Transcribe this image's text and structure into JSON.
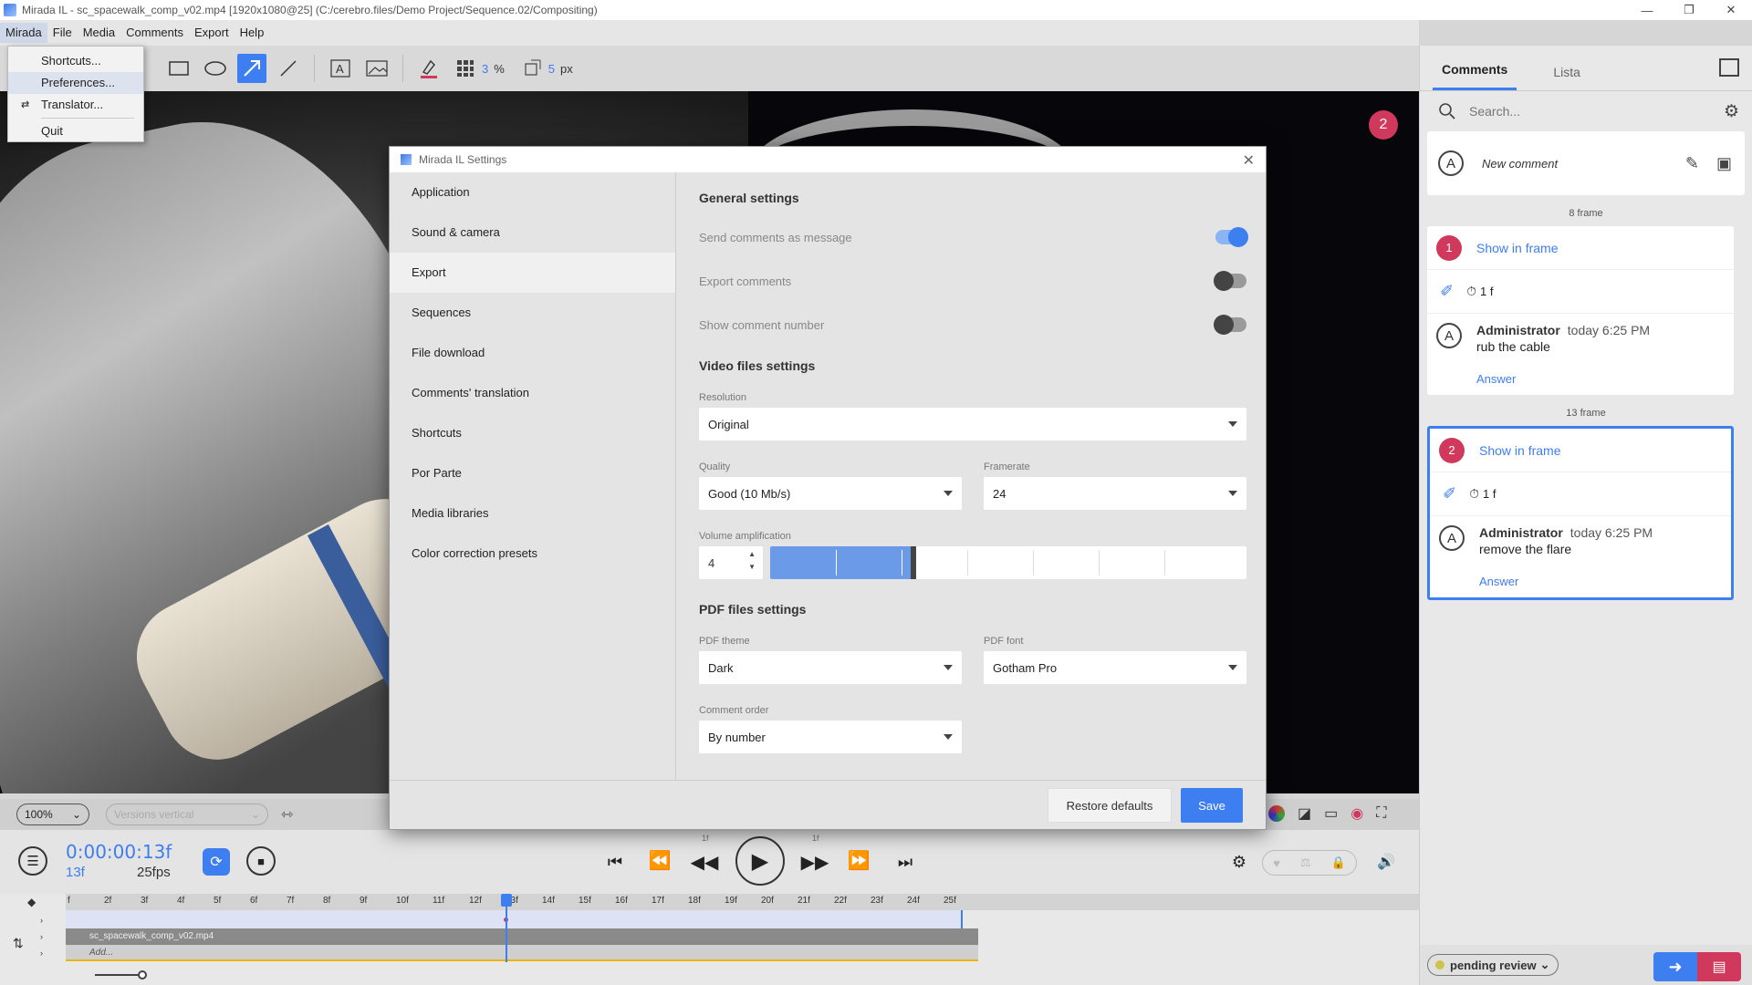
{
  "window": {
    "title": "Mirada IL - sc_spacewalk_comp_v02.mp4 [1920x1080@25] (C:/cerebro.files/Demo Project/Sequence.02/Compositing)"
  },
  "menu": {
    "items": [
      "Mirada",
      "File",
      "Media",
      "Comments",
      "Export",
      "Help"
    ],
    "dropdown": [
      "Shortcuts...",
      "Preferences...",
      "Translator...",
      "Quit"
    ]
  },
  "toolbar": {
    "grid_value": "3",
    "grid_unit": "%",
    "size_value": "5",
    "size_unit": "px"
  },
  "viewer": {
    "marker": "2",
    "zoom": "100%",
    "versions": "Versions vertical"
  },
  "transport": {
    "timecode": "0:00:00:13f",
    "frame": "13f",
    "fps": "25fps",
    "back_label": "1f",
    "fwd_label": "1f"
  },
  "timeline": {
    "ticks": [
      "f",
      "2f",
      "3f",
      "4f",
      "5f",
      "6f",
      "7f",
      "8f",
      "9f",
      "10f",
      "11f",
      "12f",
      "13f",
      "14f",
      "15f",
      "16f",
      "17f",
      "18f",
      "19f",
      "20f",
      "21f",
      "22f",
      "23f",
      "24f",
      "25f"
    ],
    "clip": "sc_spacewalk_comp_v02.mp4",
    "add": "Add..."
  },
  "panel": {
    "tabs": [
      "Comments",
      "Lista"
    ],
    "search_placeholder": "Search...",
    "new_comment": "New comment",
    "avatar_letter": "A",
    "comments": [
      {
        "frame_label": "8 frame",
        "num": "1",
        "show": "Show in frame",
        "duration": "1 f",
        "author": "Administrator",
        "time": "today 6:25 PM",
        "text": "rub the cable",
        "answer": "Answer"
      },
      {
        "frame_label": "13 frame",
        "num": "2",
        "show": "Show in frame",
        "duration": "1 f",
        "author": "Administrator",
        "time": "today 6:25 PM",
        "text": "remove the flare",
        "answer": "Answer"
      }
    ],
    "status": "pending review"
  },
  "dialog": {
    "title": "Mirada IL Settings",
    "nav": [
      "Application",
      "Sound & camera",
      "Export",
      "Sequences",
      "File download",
      "Comments' translation",
      "Shortcuts",
      "Por Parte",
      "Media libraries",
      "Color correction presets"
    ],
    "active_nav": "Export",
    "general_title": "General settings",
    "send_comments": "Send comments as message",
    "send_comments_on": true,
    "export_comments": "Export comments",
    "export_comments_on": false,
    "show_number": "Show comment number",
    "show_number_on": false,
    "video_title": "Video files settings",
    "resolution_label": "Resolution",
    "resolution": "Original",
    "quality_label": "Quality",
    "quality": "Good (10 Mb/s)",
    "framerate_label": "Framerate",
    "framerate": "24",
    "volume_label": "Volume amplification",
    "volume": "4",
    "volume_max": 10,
    "pdf_title": "PDF files settings",
    "theme_label": "PDF theme",
    "theme": "Dark",
    "font_label": "PDF font",
    "font": "Gotham Pro",
    "order_label": "Comment order",
    "order": "By number",
    "restore": "Restore defaults",
    "save": "Save"
  },
  "colors": {
    "accent": "#3d7ef0",
    "marker": "#d0385c",
    "status_dot": "#cfc44a"
  }
}
